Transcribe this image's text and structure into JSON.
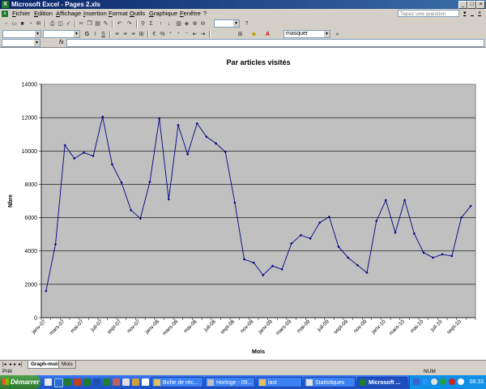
{
  "window": {
    "title": "Microsoft Excel - Pages 2.xls",
    "app_icon": "X"
  },
  "menu": [
    "Fichier",
    "Edition",
    "Affichage",
    "Insertion",
    "Format",
    "Outils",
    "Graphique",
    "Fenêtre",
    "?"
  ],
  "help_box": {
    "placeholder": "Tapez une question"
  },
  "toolbar": {
    "font_color_item": "masquer"
  },
  "formula_bar": {
    "fx": "fx"
  },
  "sheet_tabs": [
    {
      "label": "Graph-mois",
      "active": true
    },
    {
      "label": "Mois",
      "active": false
    }
  ],
  "status": {
    "left": "Prêt",
    "right": "NUM"
  },
  "taskbar": {
    "start": "Démarrer",
    "tasks": [
      {
        "label": "Boîte de réc...",
        "active": false
      },
      {
        "label": "Horloge - 09...",
        "active": false
      },
      {
        "label": "last",
        "active": false
      },
      {
        "label": "Statistiques",
        "active": false
      },
      {
        "label": "Microsoft ...",
        "active": true
      }
    ],
    "clock": "08:33"
  },
  "chart_data": {
    "type": "line",
    "title": "Par articles visités",
    "xlabel": "Mois",
    "ylabel": "Nbre",
    "ylim": [
      0,
      14000
    ],
    "yticks": [
      0,
      2000,
      4000,
      6000,
      8000,
      10000,
      12000,
      14000
    ],
    "grid": true,
    "plot_bg": "#c0c0c0",
    "line_color": "#000080",
    "x": [
      "janv-07",
      "févr-07",
      "mars-07",
      "avr-07",
      "mai-07",
      "juin-07",
      "juil-07",
      "août-07",
      "sept-07",
      "oct-07",
      "nov-07",
      "déc-07",
      "janv-08",
      "févr-08",
      "mars-08",
      "avr-08",
      "mai-08",
      "juin-08",
      "juil-08",
      "août-08",
      "sept-08",
      "oct-08",
      "nov-08",
      "déc-08",
      "janv-09",
      "févr-09",
      "mars-09",
      "avr-09",
      "mai-09",
      "juin-09",
      "juil-09",
      "août-09",
      "sept-09",
      "oct-09",
      "nov-09",
      "déc-09",
      "janv-10",
      "févr-10",
      "mars-10",
      "avr-10",
      "mai-10",
      "juin-10",
      "juil-10",
      "août-10",
      "sept-10",
      "oct-10"
    ],
    "xtick_labels": [
      "janv-07",
      "mars-07",
      "mai-07",
      "juil-07",
      "sept-07",
      "nov-07",
      "janv-08",
      "mars-08",
      "mai-08",
      "juil-08",
      "sept-08",
      "nov-08",
      "janv-09",
      "mars-09",
      "mai-09",
      "juil-09",
      "sept-09",
      "nov-09",
      "janv-10",
      "mars-10",
      "mai-10",
      "juil-10",
      "sept-10"
    ],
    "values": [
      1600,
      4400,
      10350,
      9550,
      9900,
      9700,
      12050,
      9200,
      8100,
      6450,
      5950,
      8150,
      11950,
      7100,
      11550,
      9800,
      11650,
      10850,
      10450,
      9950,
      6900,
      3500,
      3300,
      2550,
      3100,
      2900,
      4450,
      4950,
      4750,
      5700,
      6050,
      4250,
      3600,
      3150,
      2700,
      5800,
      7050,
      5100,
      7050,
      5050,
      3900,
      3600,
      3800,
      3700,
      6000,
      6700
    ]
  }
}
